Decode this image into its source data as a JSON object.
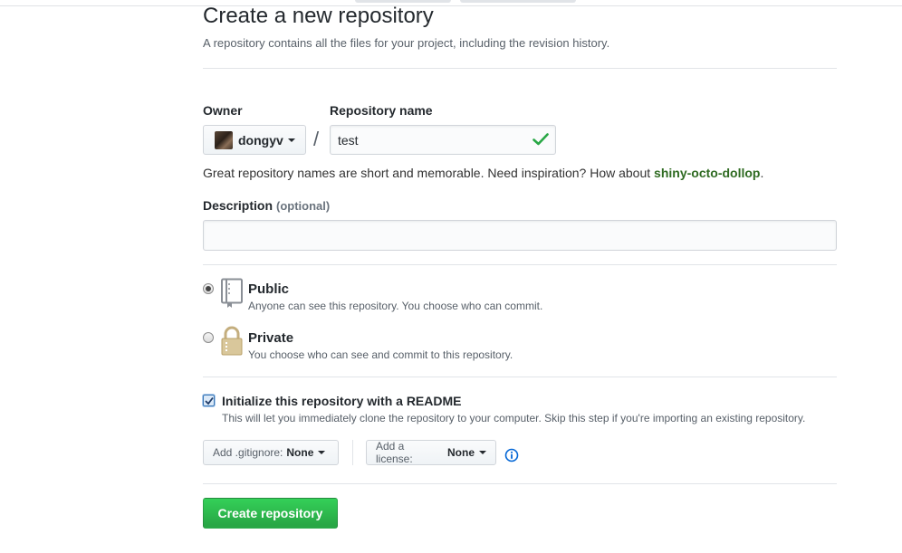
{
  "header": {
    "title": "Create a new repository",
    "subtitle": "A repository contains all the files for your project, including the revision history."
  },
  "owner": {
    "label": "Owner",
    "value": "dongyv"
  },
  "repository_name": {
    "label": "Repository name",
    "value": "test"
  },
  "hint": {
    "text": "Great repository names are short and memorable. Need inspiration? How about ",
    "suggestion": "shiny-octo-dollop",
    "end": "."
  },
  "description": {
    "label": "Description",
    "optional": "(optional)",
    "value": ""
  },
  "visibility": {
    "public": {
      "title": "Public",
      "note": "Anyone can see this repository. You choose who can commit.",
      "selected": true
    },
    "private": {
      "title": "Private",
      "note": "You choose who can see and commit to this repository.",
      "selected": false
    }
  },
  "readme": {
    "label": "Initialize this repository with a README",
    "note": "This will let you immediately clone the repository to your computer. Skip this step if you're importing an existing repository.",
    "checked": true
  },
  "gitignore": {
    "prefix": "Add .gitignore:",
    "value": "None"
  },
  "license": {
    "prefix": "Add a license:",
    "value": "None"
  },
  "submit": {
    "label": "Create repository"
  },
  "colors": {
    "primary_button": "#28a745",
    "suggestion_text": "#2f6b22",
    "check_mark": "#28a745",
    "info_icon": "#0366d6"
  }
}
